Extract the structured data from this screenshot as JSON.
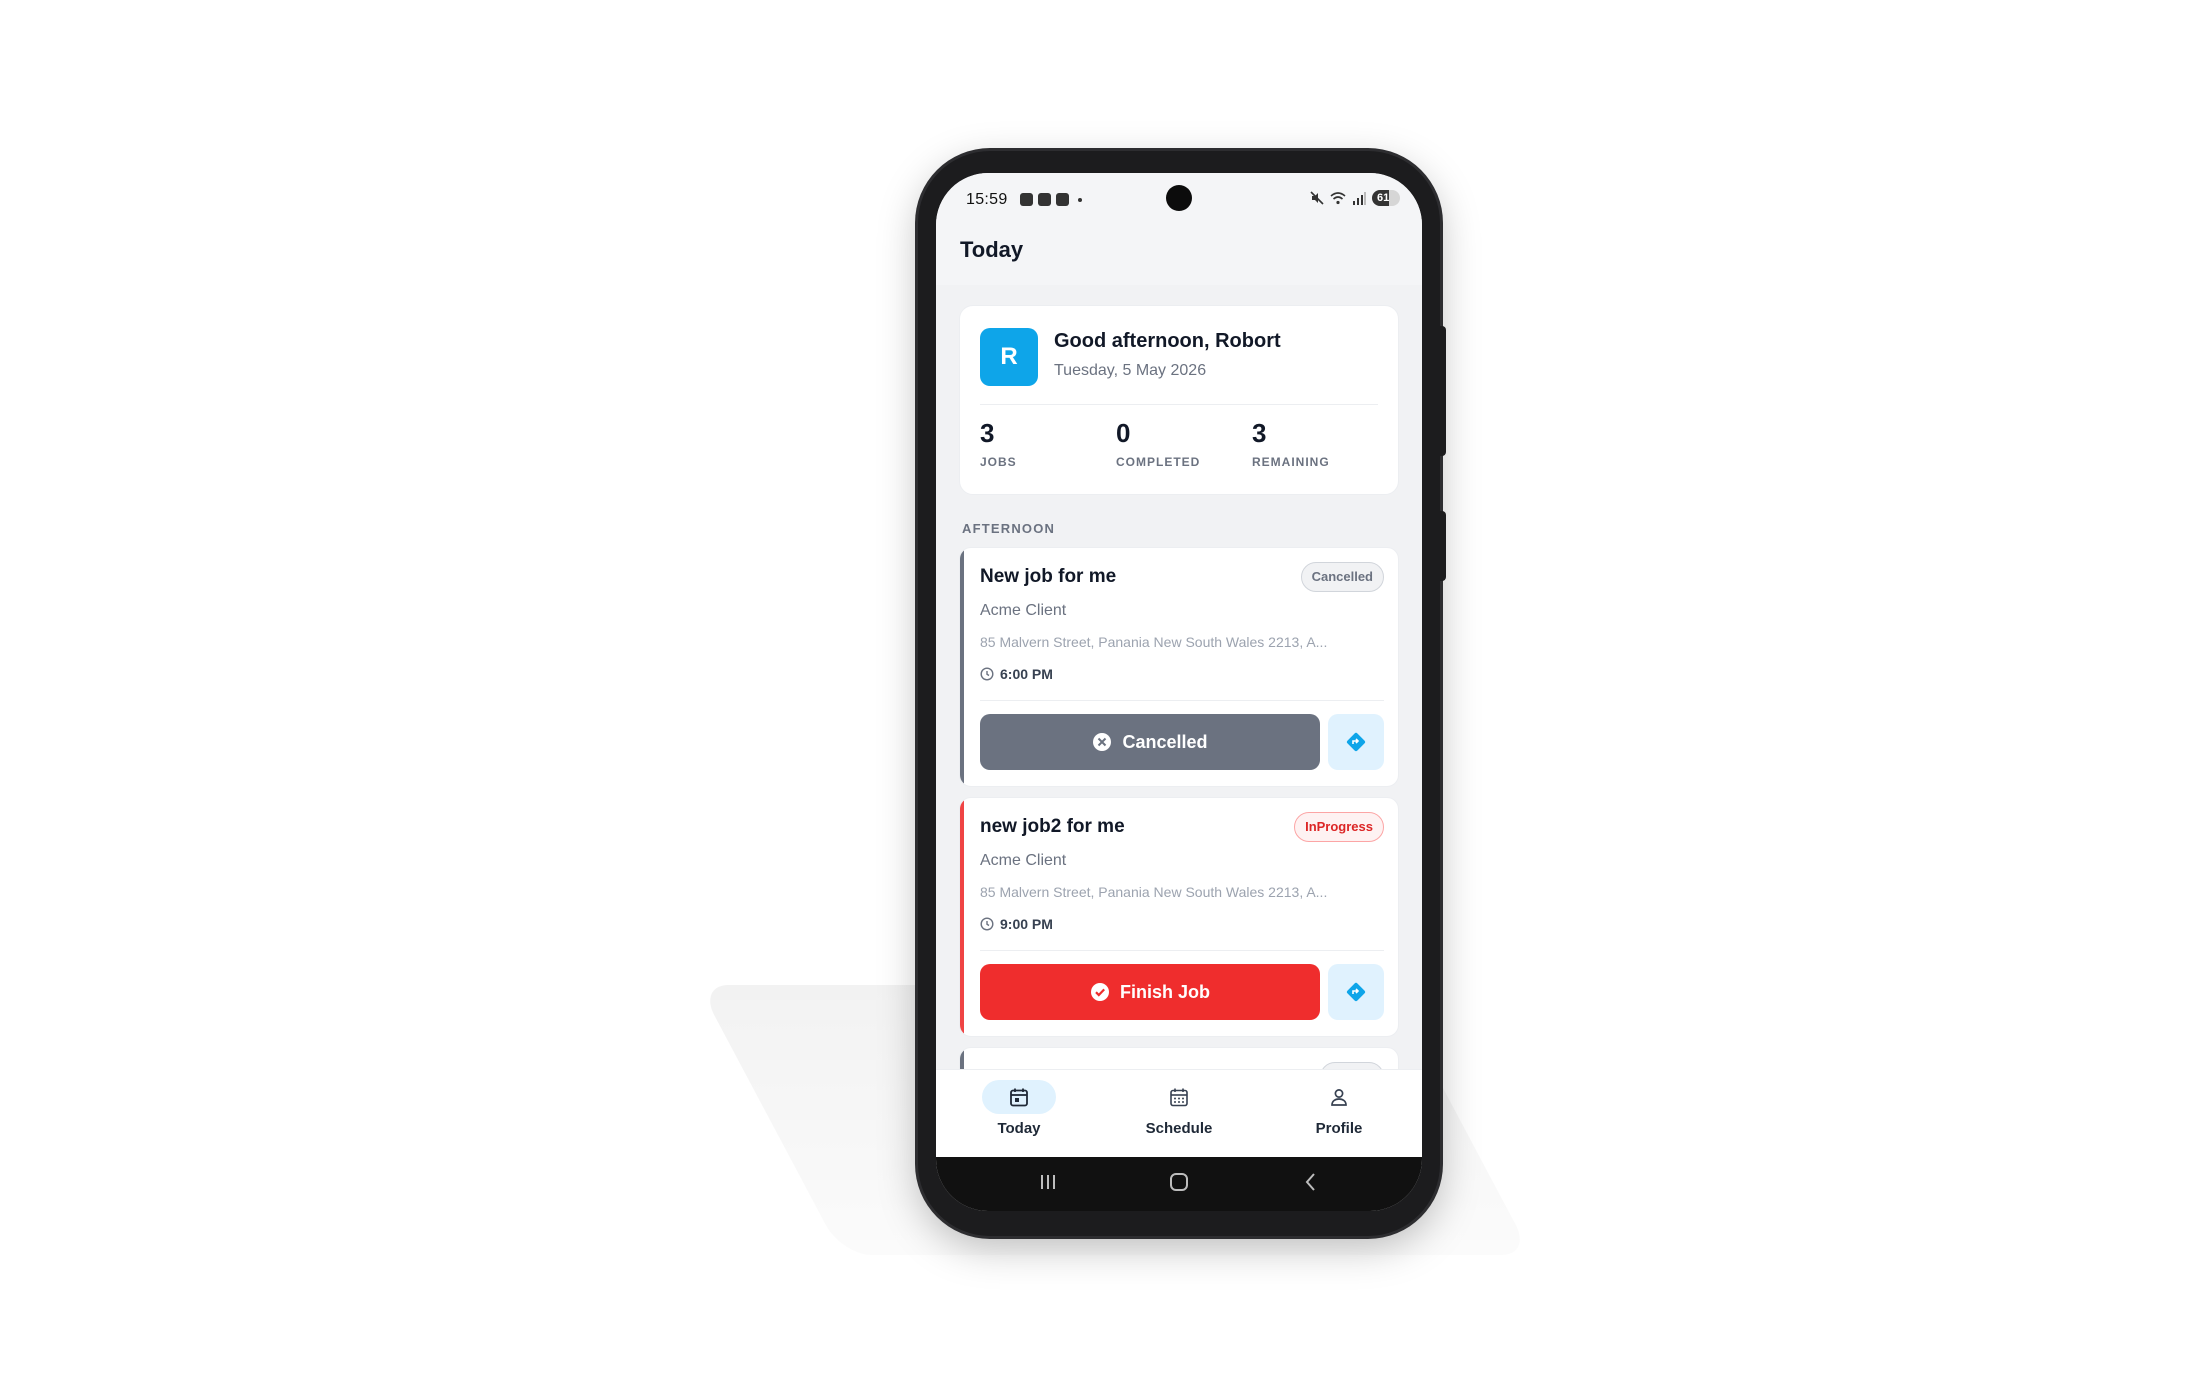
{
  "status_bar": {
    "time": "15:59",
    "battery_level": "61"
  },
  "header": {
    "title": "Today"
  },
  "greeting": {
    "avatar_initial": "R",
    "title": "Good afternoon, Robort",
    "date": "Tuesday, 5 May 2026",
    "stats": [
      {
        "value": "3",
        "label": "JOBS"
      },
      {
        "value": "0",
        "label": "COMPLETED"
      },
      {
        "value": "3",
        "label": "REMAINING"
      }
    ]
  },
  "section_label": "AFTERNOON",
  "jobs": [
    {
      "title": "New job for me",
      "status": "Cancelled",
      "client": "Acme Client",
      "address": "85 Malvern Street, Panania New South Wales 2213, A...",
      "time": "6:00 PM",
      "action_label": "Cancelled"
    },
    {
      "title": "new job2 for me",
      "status": "InProgress",
      "client": "Acme Client",
      "address": "85 Malvern Street, Panania New South Wales 2213, A...",
      "time": "9:00 PM",
      "action_label": "Finish Job"
    }
  ],
  "bottom_nav": [
    {
      "label": "Today",
      "icon": "calendar-day-icon",
      "active": true
    },
    {
      "label": "Schedule",
      "icon": "calendar-grid-icon",
      "active": false
    },
    {
      "label": "Profile",
      "icon": "person-icon",
      "active": false
    }
  ],
  "colors": {
    "accent": "#0ea5e9",
    "danger": "#ef2d2d",
    "muted": "#6b7280"
  }
}
